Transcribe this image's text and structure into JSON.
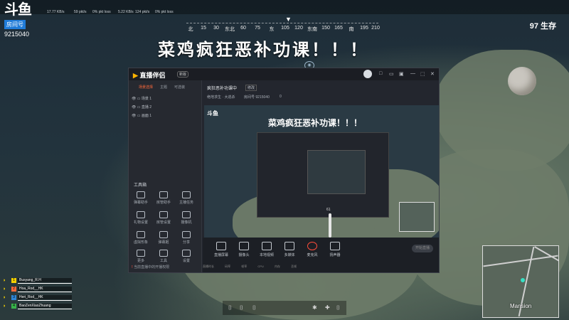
{
  "overlay": {
    "logo_mark": "斗鱼",
    "logo_tag": "房间号",
    "room_number": "9215040",
    "net_stats": [
      "17.77 KB/s",
      "59 pkt/s",
      "0% pkt loss",
      "5.22 KB/s",
      "124 pkt/s",
      "0% pkt loss"
    ],
    "banner": "菜鸡疯狂恶补功课！！！",
    "survivors": "97 生存"
  },
  "compass": {
    "ticks": [
      "北",
      "15",
      "30",
      "东北",
      "60",
      "75",
      "东",
      "105",
      "120",
      "东南",
      "150",
      "165",
      "南",
      "195",
      "210"
    ],
    "marker": "▼"
  },
  "app": {
    "name": "直播伴侣",
    "badge": "新版",
    "window_controls": [
      "□",
      "▭",
      "▣",
      "—",
      "⬚",
      "✕"
    ],
    "side_tabs": [
      "场景选择",
      "主题",
      "可选装"
    ],
    "scenes": [
      "场景 1",
      "直播 2",
      "画面 1"
    ],
    "tools_label": "工具箱",
    "tools": [
      "弹幕助手",
      "房管助手",
      "主播任务",
      "礼物设置",
      "房管设置",
      "摄像机",
      "虚拟形象",
      "弹幕姬",
      "分享",
      "更多",
      "工具",
      "设置"
    ],
    "footer_warning": "!",
    "footer_text": "当前直播中的开播权限",
    "stream": {
      "title": "疯狂恶补功课中",
      "mod": "修改",
      "category": "绝地求生 · 大逃杀",
      "room": "房间号 9215040",
      "fans": "0"
    },
    "toolbar": [
      {
        "label": "直播屏幕",
        "name": "screen-capture"
      },
      {
        "label": "摄像头",
        "name": "camera"
      },
      {
        "label": "本地视频",
        "name": "local-video"
      },
      {
        "label": "多媒体",
        "name": "multimedia"
      },
      {
        "label": "麦克风",
        "name": "microphone"
      },
      {
        "label": "扬声器",
        "name": "speaker"
      }
    ],
    "start_button": "开始直播",
    "status": [
      "直播时长",
      "码率",
      "帧率",
      "CPU",
      "内存",
      "丢帧"
    ],
    "volume": "61"
  },
  "preview": {
    "banner": "菜鸡疯狂恶补功课！！！",
    "logo": "斗鱼"
  },
  "players": [
    {
      "num": "1",
      "name": "Busyang_R.H",
      "color": "#f5d000"
    },
    {
      "num": "2",
      "name": "Hoa_Rod__HK",
      "color": "#ff6a3c"
    },
    {
      "num": "3",
      "name": "Heri_Rod__HK",
      "color": "#2f86d6"
    },
    {
      "num": "4",
      "name": "BaoZenXiaoZhuang",
      "color": "#38b24a"
    }
  ],
  "minimap": {
    "location": "Mansion"
  },
  "colors": {
    "accent": "#ff6a3c",
    "douyu_blue": "#1f7bd8",
    "record_red": "#ff4d3a"
  }
}
